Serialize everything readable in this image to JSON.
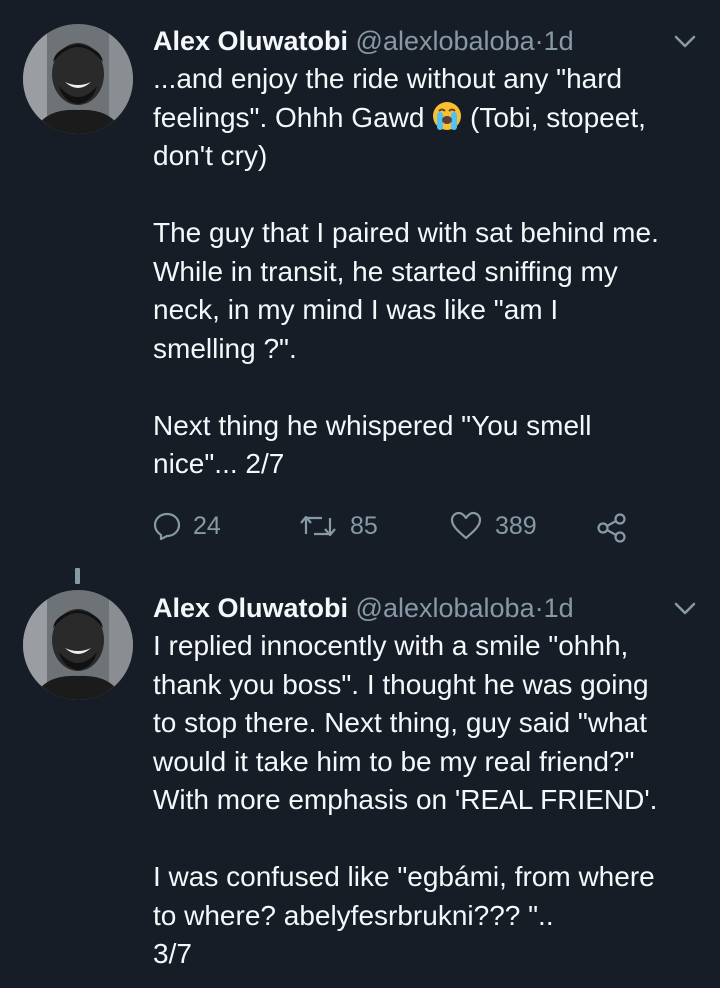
{
  "tweets": [
    {
      "author_name": "Alex Oluwatobi",
      "handle": "@alexlobaloba",
      "separator": "·",
      "time": "1d",
      "text_part1": "...and enjoy the ride without any \"hard\nfeelings\". Ohhh Gawd ",
      "emoji_icon": "loudly-crying-face",
      "text_part2": " (Tobi, stopeet,\ndon't cry)\n\nThe guy that I paired with sat behind me.\nWhile in transit, he started sniffing my\nneck, in my mind I was like \"am I\nsmelling ?\".\n\nNext thing he whispered \"You smell\nnice\"... 2/7",
      "replies": "24",
      "retweets": "85",
      "likes": "389"
    },
    {
      "author_name": "Alex Oluwatobi",
      "handle": "@alexlobaloba",
      "separator": "·",
      "time": "1d",
      "text": "I replied innocently with a smile \"ohhh,\nthank you boss\". I thought he was going\nto stop there. Next thing, guy said \"what\nwould it take him to be my real friend?\"\nWith more emphasis on 'REAL FRIEND'.\n\nI was confused like \"egbámi, from where\nto where? abelyfesrbrukni??? \"..\n3/7"
    }
  ],
  "colors": {
    "background": "#161d27",
    "primary_text": "#f5f8fa",
    "secondary_text": "#8899a6"
  }
}
